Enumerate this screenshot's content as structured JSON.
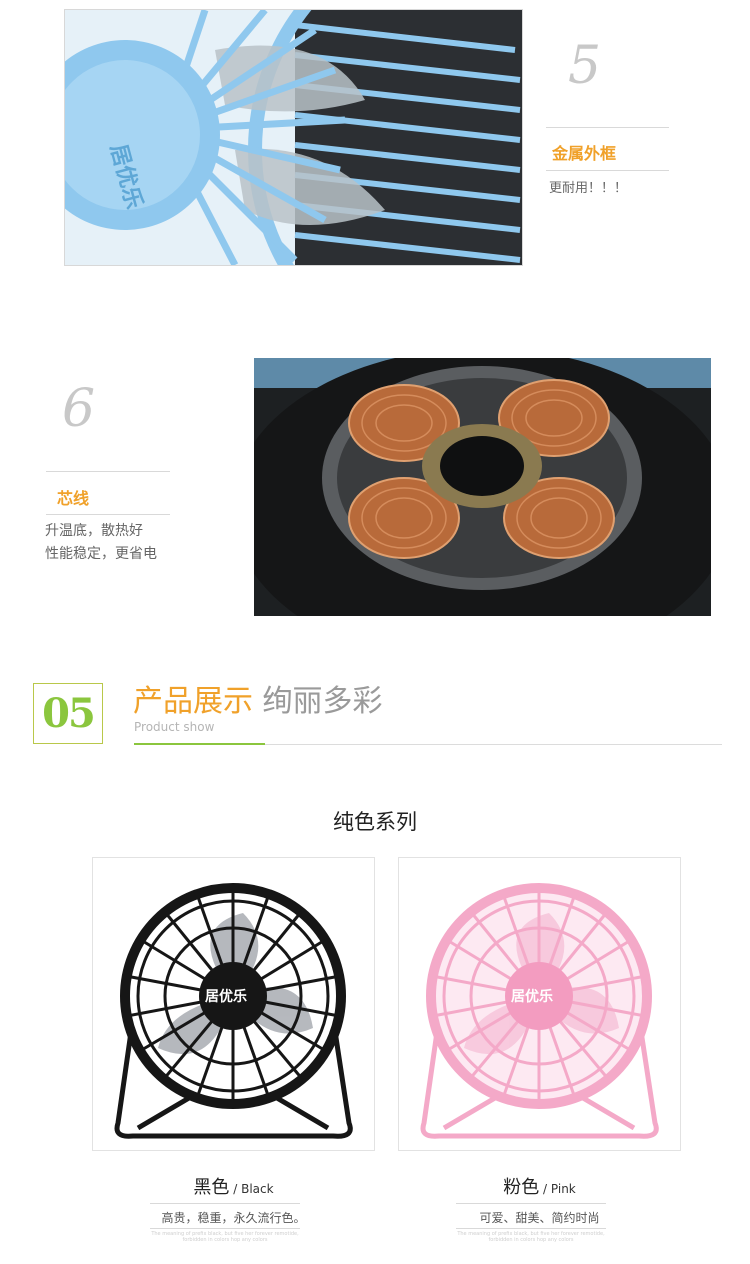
{
  "features": [
    {
      "number": "5",
      "title": "金属外框",
      "desc": [
        "更耐用！！！"
      ]
    },
    {
      "number": "6",
      "title": "芯线",
      "desc": [
        "升温底，散热好",
        "性能稳定，更省电"
      ]
    }
  ],
  "brand_on_fan": "居优乐",
  "section": {
    "number": "05",
    "title_main": "产品展示",
    "title_accent": "绚丽多彩",
    "subtitle": "Product show"
  },
  "series_title": "纯色系列",
  "products": [
    {
      "name": "黑色",
      "name_en": "Black",
      "desc": "高贵，稳重，永久流行色。",
      "fine_print": "The meaning of prefix black, but five her forever remotide, forbidden in colors hop any colors"
    },
    {
      "name": "粉色",
      "name_en": "Pink",
      "desc": "可爱、甜美、简约时尚",
      "fine_print": "The meaning of prefix black, but five her forever remotide, forbidden in colors hop any colors"
    }
  ],
  "colors": {
    "accent_orange": "#f0a12a",
    "accent_green": "#8bc63e",
    "fan_blue": "#8fc8ee",
    "fan_black": "#161616",
    "fan_pink": "#f4a9c8"
  }
}
